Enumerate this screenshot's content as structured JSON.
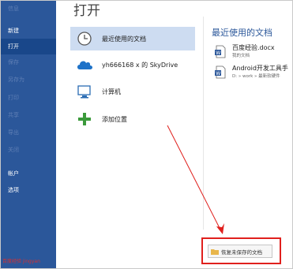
{
  "rail": {
    "items": [
      {
        "label": "信息",
        "dim": true
      },
      {
        "label": "新建",
        "dim": false
      },
      {
        "label": "打开",
        "dim": false,
        "active": true
      },
      {
        "label": "保存",
        "dim": true
      },
      {
        "label": "另存为",
        "dim": true
      },
      {
        "label": "打印",
        "dim": true
      },
      {
        "label": "共享",
        "dim": true
      },
      {
        "label": "导出",
        "dim": true
      },
      {
        "label": "关闭",
        "dim": true
      },
      {
        "label": "帐户",
        "dim": false
      },
      {
        "label": "选项",
        "dim": false
      }
    ],
    "watermark": "百度经验 jingyan"
  },
  "main": {
    "title": "打开",
    "locations": [
      {
        "label": "最近使用的文档",
        "icon": "clock-icon",
        "selected": true
      },
      {
        "label": "yh666168 x 的 SkyDrive",
        "icon": "cloud-icon",
        "selected": false
      },
      {
        "label": "计算机",
        "icon": "computer-icon",
        "selected": false
      },
      {
        "label": "添加位置",
        "icon": "plus-icon",
        "selected": false
      }
    ]
  },
  "recent": {
    "title": "最近使用的文档",
    "docs": [
      {
        "name": "百度经验.docx",
        "path": "我的文档"
      },
      {
        "name": "Android开发工具手",
        "path": "D: » work » 最新软硬件"
      }
    ]
  },
  "recover": {
    "label": "恢复未保存的文档"
  },
  "colors": {
    "rail": "#2b579a",
    "accent": "#2b579a",
    "highlight": "#cddcf1",
    "annotation": "#e0201d"
  }
}
